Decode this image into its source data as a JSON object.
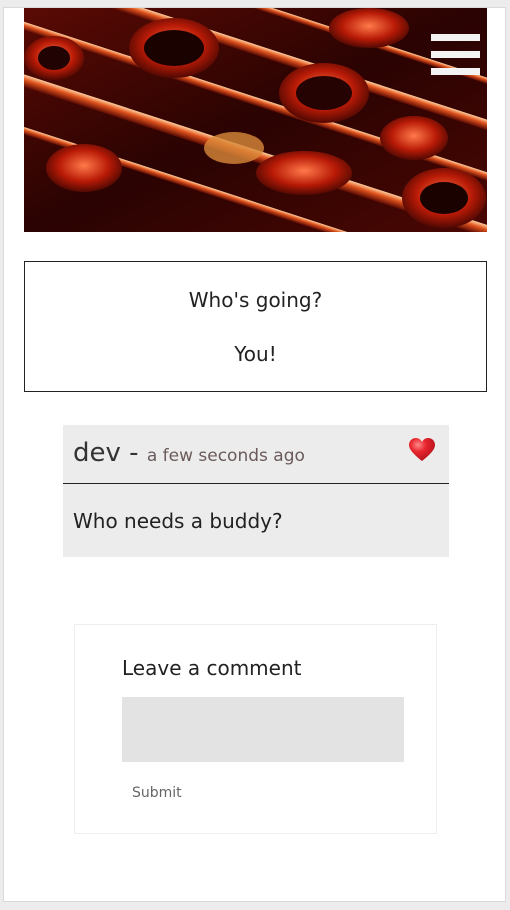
{
  "header": {
    "hero_image": "saxophone-keys-photo",
    "menu_icon": "hamburger-menu-icon"
  },
  "event": {
    "question": "Who's going?",
    "answer": "You!"
  },
  "comment": {
    "author": "dev",
    "separator": "-",
    "time": "a few seconds ago",
    "like_icon": "heart-icon",
    "text": "Who needs a buddy?"
  },
  "comment_form": {
    "title": "Leave a comment",
    "input_value": "",
    "submit_label": "Submit"
  },
  "colors": {
    "page_bg": "#ececec",
    "card_bg": "#ececec",
    "input_bg": "#e3e3e3",
    "heart": "#e0242c",
    "time_text": "#6a5a5a"
  }
}
